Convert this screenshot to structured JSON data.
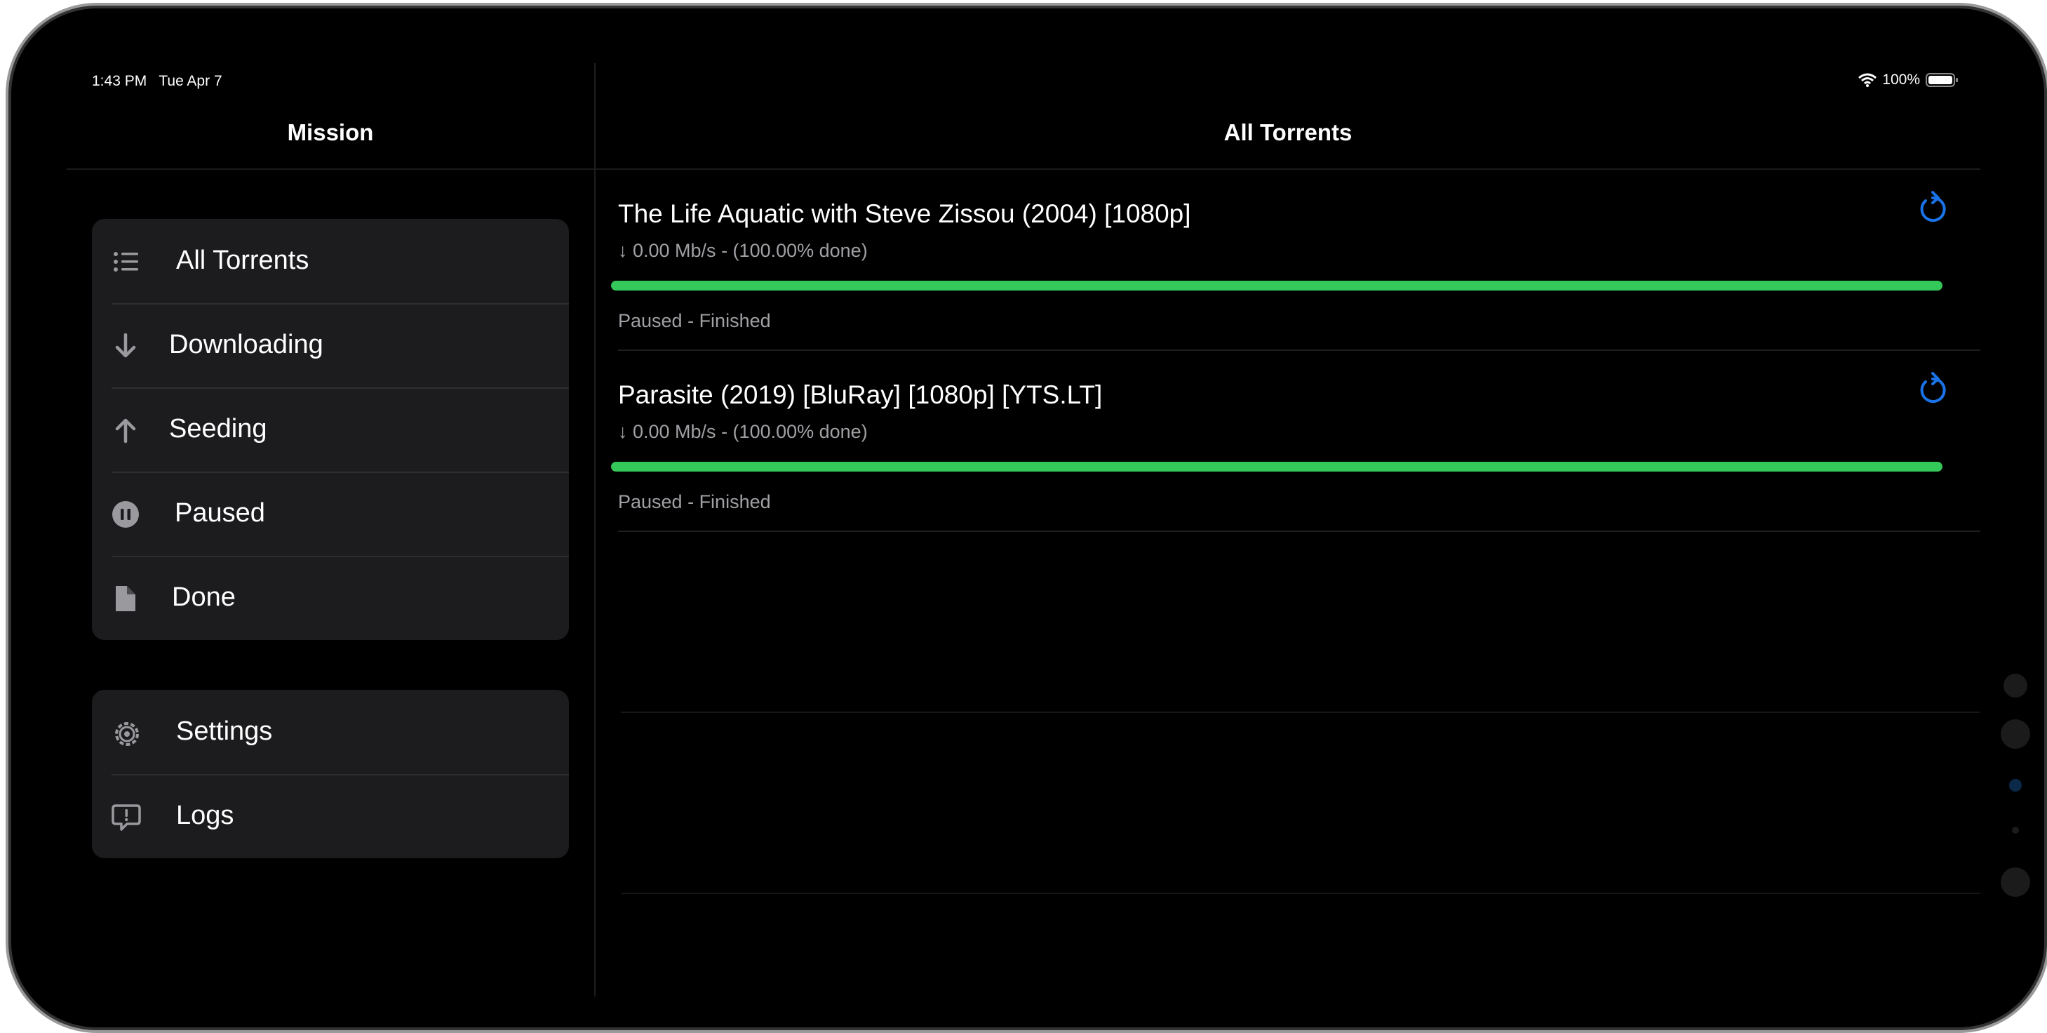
{
  "status_bar": {
    "time": "1:43 PM",
    "date": "Tue Apr 7",
    "battery": "100%",
    "wifi_icon": "wifi-icon",
    "battery_icon": "battery-icon"
  },
  "sidebar": {
    "title": "Mission",
    "filters": [
      {
        "label": "All Torrents",
        "icon": "list-icon"
      },
      {
        "label": "Downloading",
        "icon": "arrow-down-icon"
      },
      {
        "label": "Seeding",
        "icon": "arrow-up-icon"
      },
      {
        "label": "Paused",
        "icon": "pause-circle-icon"
      },
      {
        "label": "Done",
        "icon": "document-icon"
      }
    ],
    "extras": [
      {
        "label": "Settings",
        "icon": "gear-icon"
      },
      {
        "label": "Logs",
        "icon": "chat-alert-icon"
      }
    ]
  },
  "main": {
    "title": "All Torrents",
    "torrents": [
      {
        "name": "The Life Aquatic with Steve Zissou (2004) [1080p]",
        "speed": "↓ 0.00 Mb/s  - (100.00% done)",
        "progress": 1.0,
        "status": "Paused - Finished"
      },
      {
        "name": "Parasite (2019) [BluRay] [1080p] [YTS.LT]",
        "speed": "↓ 0.00 Mb/s  - (100.00% done)",
        "progress": 1.0,
        "status": "Paused - Finished"
      }
    ]
  },
  "colors": {
    "progress": "#34c759",
    "refresh": "#1a73e8",
    "delete": "#ff3b30",
    "background": "#000000",
    "group_background": "#1c1c1e"
  }
}
